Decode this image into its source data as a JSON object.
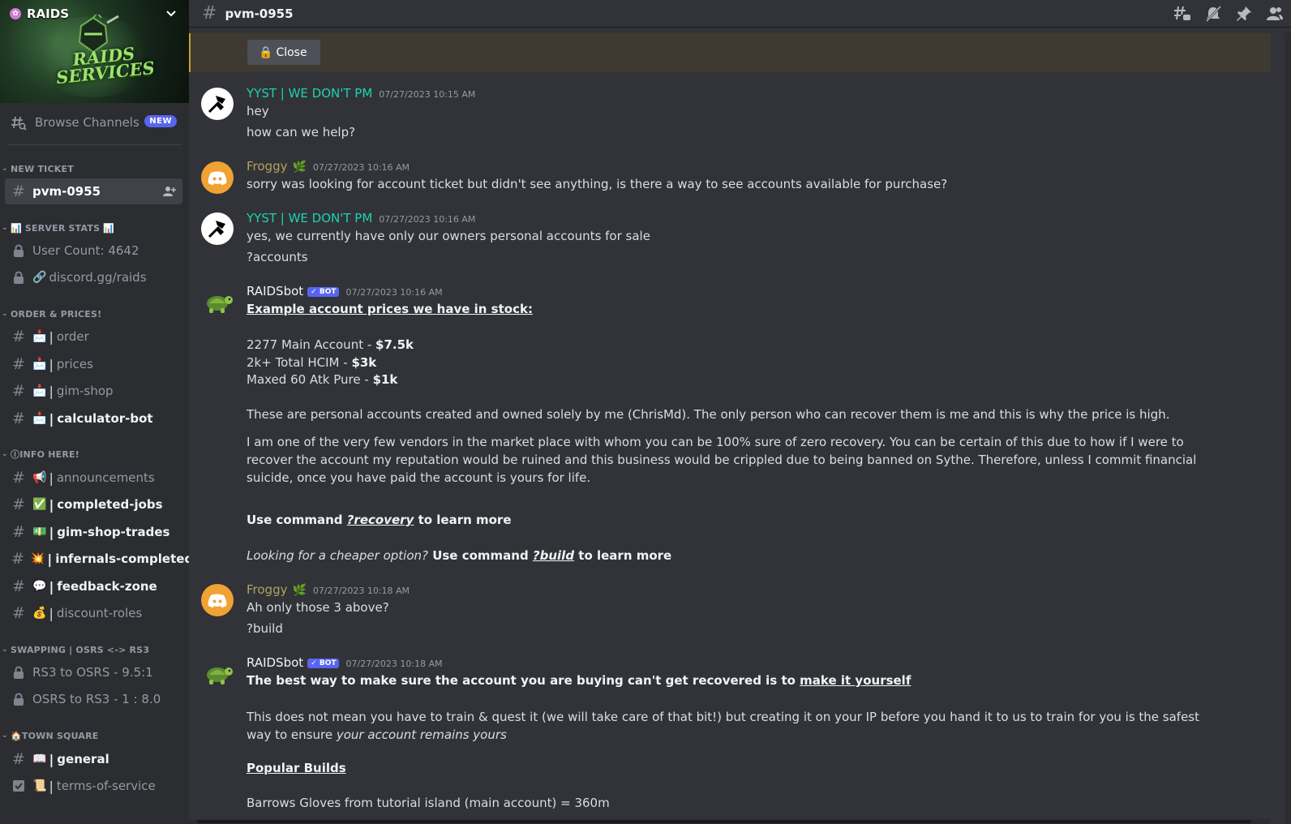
{
  "server": {
    "name": "RAIDS",
    "banner_text": [
      "RAIDS",
      "SERVICES"
    ]
  },
  "browse": {
    "label": "Browse Channels",
    "badge": "NEW"
  },
  "categories": [
    {
      "label": "NEW TICKET"
    },
    {
      "label": "SERVER STATS 📊"
    },
    {
      "label": "ORDER & PRICES!"
    },
    {
      "label": "INFO HERE!"
    },
    {
      "label": "SWAPPING | OSRS <-> RS3"
    },
    {
      "label": "TOWN SQUARE"
    }
  ],
  "category_prefix": {
    "server_stats": "📊",
    "info": "ⓘ",
    "town_square": "🏠"
  },
  "channels": {
    "pvm": {
      "name": "pvm-0955"
    },
    "user_count": {
      "name": "User Count: 4642"
    },
    "discord_link": {
      "emoji": "🔗",
      "name": "discord.gg/raids"
    },
    "order": {
      "emoji": "📩",
      "name": "order"
    },
    "prices": {
      "emoji": "📩",
      "name": "prices"
    },
    "gim_shop": {
      "emoji": "📩",
      "name": "gim-shop"
    },
    "calculator": {
      "emoji": "📩",
      "name": "calculator-bot"
    },
    "announcements": {
      "emoji": "📢",
      "name": "announcements"
    },
    "completed": {
      "emoji": "✅",
      "name": "completed-jobs"
    },
    "gim_trades": {
      "emoji": "💵",
      "name": "gim-shop-trades"
    },
    "infernals": {
      "emoji": "💥",
      "name": "infernals-completed"
    },
    "feedback": {
      "emoji": "💬",
      "name": "feedback-zone"
    },
    "discount": {
      "emoji": "💰",
      "name": "discount-roles"
    },
    "rs3_osrs": {
      "name": "RS3 to OSRS - 9.5:1"
    },
    "osrs_rs3": {
      "name": "OSRS to RS3 - 1 : 8.0"
    },
    "general": {
      "emoji": "📖",
      "name": "general"
    },
    "tos": {
      "emoji": "📜",
      "name": "terms-of-service"
    }
  },
  "topbar": {
    "channel": "pvm-0955"
  },
  "ticket": {
    "close_label": "Close",
    "close_emoji": "🔒"
  },
  "messages": [
    {
      "author": "YYST | WE DON'T PM",
      "time": "07/27/2023 10:15 AM",
      "lines": [
        "hey",
        "how can we help?"
      ]
    },
    {
      "author": "Froggy",
      "time": "07/27/2023 10:16 AM",
      "lines": [
        "sorry was looking for account ticket but didn't see anything, is there a way to see accounts available for purchase?"
      ]
    },
    {
      "author": "YYST | WE DON'T PM",
      "time": "07/27/2023 10:16 AM",
      "lines": [
        "yes, we currently have only our owners personal accounts for sale",
        "?accounts"
      ]
    },
    {
      "author": "RAIDSbot",
      "badge": "✓ BOT",
      "time": "07/27/2023 10:16 AM",
      "heading": "Example account prices we have in stock:",
      "prices": [
        {
          "label": "2277 Main Account - ",
          "price": "$7.5k"
        },
        {
          "label": "2k+ Total HCIM - ",
          "price": "$3k"
        },
        {
          "label": "Maxed 60 Atk Pure - ",
          "price": "$1k"
        }
      ],
      "para1": "These are personal accounts created and owned solely by me (ChrisMd). The only person who can recover them is me and this is why the price is high.",
      "para2": "I am one of the very few vendors in the market place with whom you can be 100% sure of zero recovery. You can be certain of this due to how if I were to recover the account my reputation would be ruined and this business would be crippled due to being banned on Sythe. Therefore, unless I commit financial suicide, once you have paid the account is yours for life.",
      "cmd1_pre": "Use command ",
      "cmd1": "?recovery",
      "cmd1_post": " to learn more",
      "cmd2_italic": "Looking for a cheaper option?",
      "cmd2_pre": " Use command ",
      "cmd2": "?build",
      "cmd2_post": " to learn more"
    },
    {
      "author": "Froggy",
      "time": "07/27/2023 10:18 AM",
      "lines": [
        "Ah only those 3 above?",
        "?build"
      ]
    },
    {
      "author": "RAIDSbot",
      "badge": "✓ BOT",
      "time": "07/27/2023 10:18 AM",
      "bold_pre": "The best way to make sure the account you are buying can't get recovered is to ",
      "bold_link": "make it yourself",
      "para_pre": "This does not mean you have to train & quest it (we will take care of that bit!) but creating it on your IP before you hand it to us to train for you is the safest way to ensure ",
      "para_italic": "your account remains yours",
      "popular": "Popular Builds",
      "cut_line": "Barrows Gloves from tutorial island (main account) = 360m"
    }
  ],
  "colors": {
    "yyst": "#1dd3b0",
    "froggy": "#b1a35f",
    "accent": "#5865f2",
    "ticket_bar": "#3e3a31"
  }
}
